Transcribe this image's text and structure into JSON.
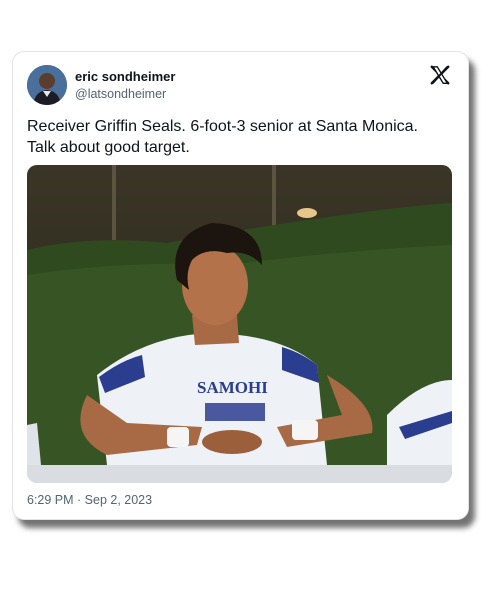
{
  "tweet": {
    "author_name": "eric sondheimer",
    "author_handle": "@latsondheimer",
    "text": "Receiver Griffin Seals. 6-foot-3 senior at Santa Monica. Talk about good target.",
    "timestamp": "6:29 PM · Sep 2, 2023",
    "jersey_text": "SAMOHI",
    "icons": [
      "x-logo-icon"
    ]
  }
}
